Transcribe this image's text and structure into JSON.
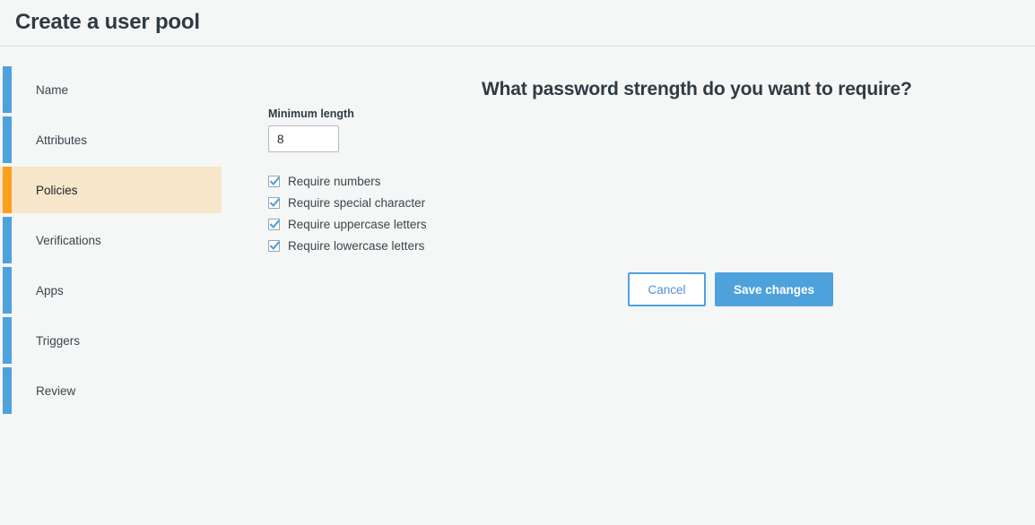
{
  "header": {
    "title": "Create a user pool"
  },
  "sidebar": {
    "active_index": 2,
    "items": [
      {
        "label": "Name"
      },
      {
        "label": "Attributes"
      },
      {
        "label": "Policies"
      },
      {
        "label": "Verifications"
      },
      {
        "label": "Apps"
      },
      {
        "label": "Triggers"
      },
      {
        "label": "Review"
      }
    ]
  },
  "main": {
    "question": "What password strength do you want to require?",
    "form": {
      "min_length_label": "Minimum length",
      "min_length_value": "8",
      "min_length_placeholder": "",
      "requirements": [
        {
          "label": "Require numbers",
          "checked": true
        },
        {
          "label": "Require special character",
          "checked": true
        },
        {
          "label": "Require uppercase letters",
          "checked": true
        },
        {
          "label": "Require lowercase letters",
          "checked": true
        }
      ]
    },
    "actions": {
      "cancel_label": "Cancel",
      "save_label": "Save changes"
    }
  },
  "colors": {
    "accent_blue": "#4ea2dc",
    "accent_orange": "#fba01d",
    "active_row_bg": "#f7e6ca",
    "page_bg": "#f5f6f6",
    "text_dark": "#2e3b43"
  }
}
